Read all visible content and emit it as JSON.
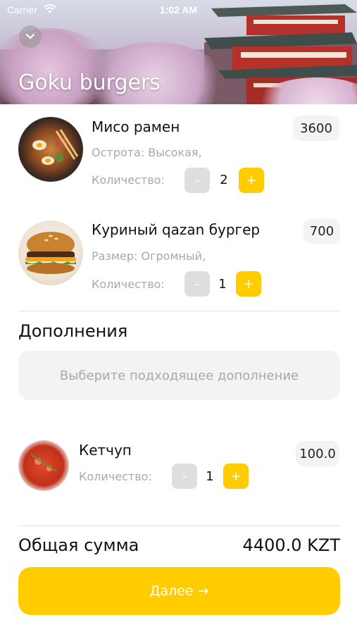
{
  "status_bar": {
    "carrier": "Carrier",
    "time": "1:02 AM"
  },
  "header": {
    "title": "Goku burgers",
    "back_icon": "chevron-down-icon"
  },
  "cart_items": [
    {
      "name": "Мисо рамен",
      "option": "Острота: Высокая,",
      "quantity_label": "Количество:",
      "quantity": "2",
      "minus": "-",
      "plus": "+",
      "price": "3600"
    },
    {
      "name": "Куриный qazan бургер",
      "option": "Размер: Огромный,",
      "quantity_label": "Количество:",
      "quantity": "1",
      "minus": "-",
      "plus": "+",
      "price": "700"
    }
  ],
  "addons": {
    "title": "Дополнения",
    "placeholder": "Выберите подходящее дополнение",
    "items": [
      {
        "name": "Кетчуп",
        "quantity_label": "Количество:",
        "quantity": "1",
        "minus": "-",
        "plus": "+",
        "price": "100.0"
      }
    ]
  },
  "total": {
    "label": "Общая сумма",
    "value": "4400.0 KZT"
  },
  "next_button": {
    "label": "Далее →"
  },
  "colors": {
    "accent": "#ffcc00",
    "muted": "#a8a8a8",
    "chip": "#f3f3f3",
    "minus_btn": "#dedede"
  }
}
